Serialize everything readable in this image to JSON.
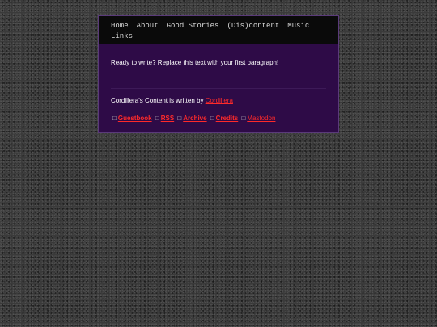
{
  "nav": {
    "items": [
      "Home",
      "About",
      "Good Stories",
      "(Dis)content",
      "Music",
      "Links"
    ]
  },
  "content": {
    "first_paragraph": "Ready to write? Replace this text with your first paragraph!",
    "written_by_prefix": "Cordillera's Content is written by ",
    "author_link": "Cordillera"
  },
  "footer_links": {
    "separator": "□",
    "items": [
      "Guestbook",
      "RSS",
      "Archive",
      "Credits",
      "Mastodon"
    ]
  },
  "colors": {
    "panel": "#2e0b47",
    "nav_bg": "#0a0a0a",
    "link": "#ff2a2a"
  }
}
